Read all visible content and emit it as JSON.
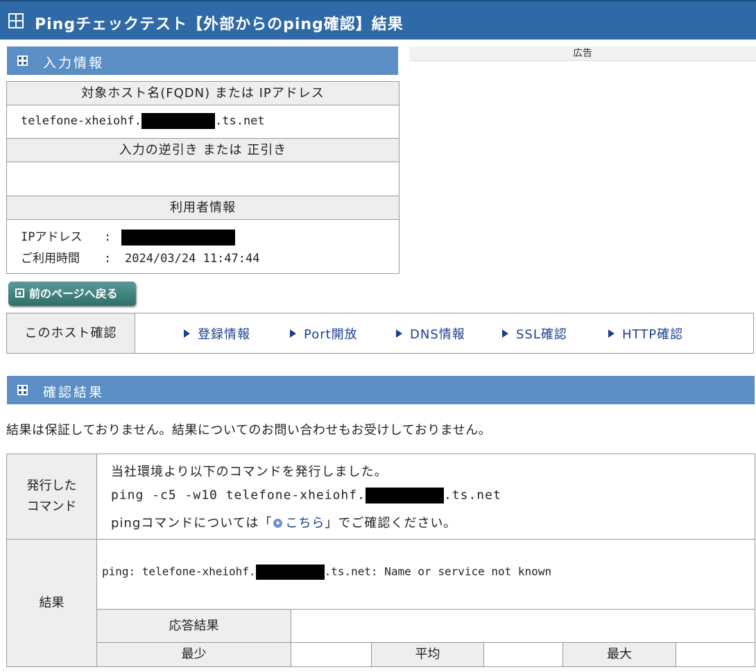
{
  "page": {
    "title": "Pingチェックテスト【外部からのping確認】結果",
    "ad_label": "広告"
  },
  "input_section": {
    "heading": "入力情報",
    "host_header": "対象ホスト名(FQDN) または IPアドレス",
    "host_value_prefix": "telefone-xheiohf.",
    "host_value_suffix": ".ts.net",
    "reverse_header": "入力の逆引き または 正引き",
    "reverse_value": "",
    "user_header": "利用者情報",
    "ip_label": "IPアドレス",
    "time_label": "ご利用時間",
    "separator": ":",
    "time_value": "2024/03/24 11:47:44"
  },
  "back_button": {
    "label": "前のページへ戻る"
  },
  "host_check": {
    "label": "このホスト確認",
    "links": [
      "登録情報",
      "Port開放",
      "DNS情報",
      "SSL確認",
      "HTTP確認"
    ]
  },
  "result_section": {
    "heading": "確認結果",
    "notice": "結果は保証しておりません。結果についてのお問い合わせもお受けしておりません。",
    "command_label_line1": "発行した",
    "command_label_line2": "コマンド",
    "command_intro": "当社環境より以下のコマンドを発行しました。",
    "command_prefix": "ping -c5 -w10 telefone-xheiohf.",
    "command_suffix": ".ts.net",
    "help_before": "pingコマンドについては「",
    "help_link": "こちら",
    "help_after": "」でご確認ください。",
    "result_label": "結果",
    "result_prefix": "ping: telefone-xheiohf.",
    "result_suffix": ".ts.net: Name or service not known",
    "response_label": "応答結果",
    "response_value": "",
    "min_label": "最少",
    "avg_label": "平均",
    "max_label": "最大",
    "min_value": "",
    "avg_value": "",
    "max_value": ""
  }
}
